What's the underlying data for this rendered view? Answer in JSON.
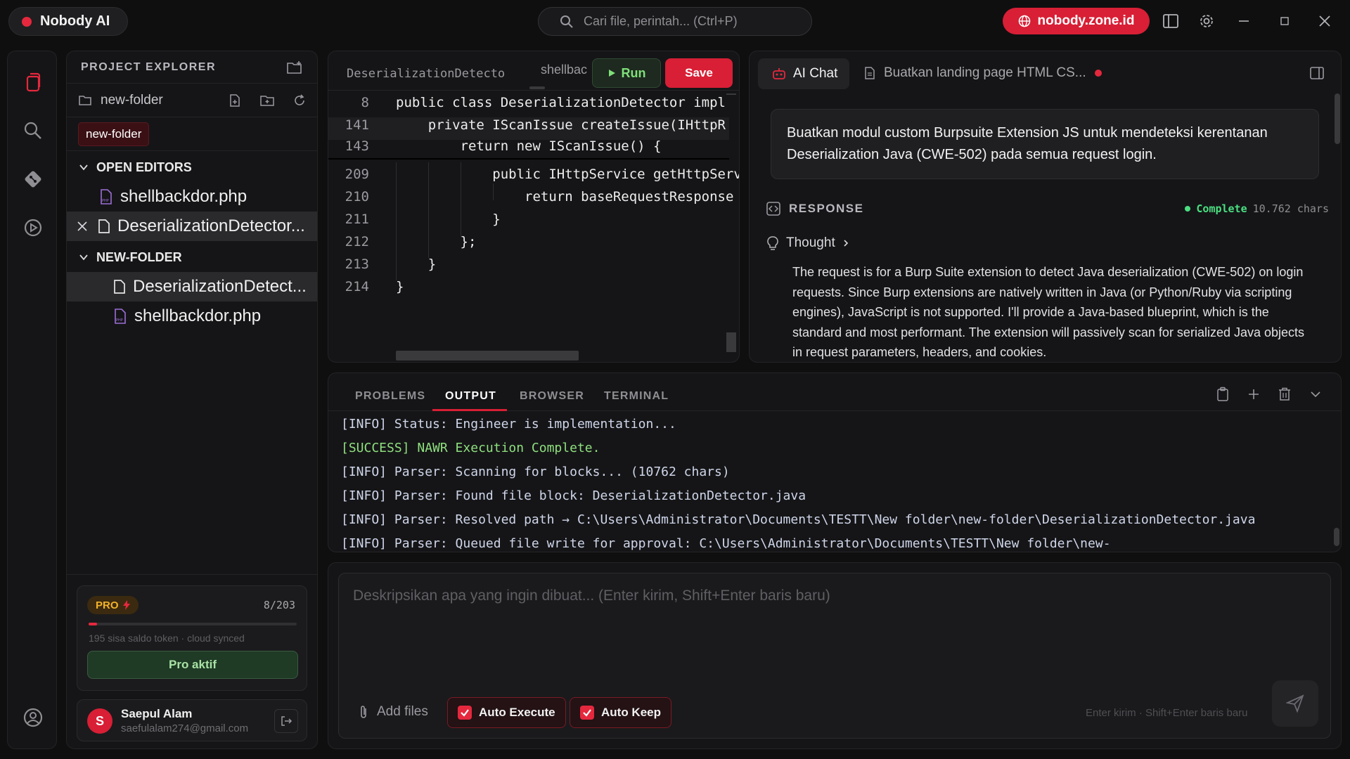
{
  "app": {
    "name": "Nobody AI",
    "site_label": "nobody.zone.id"
  },
  "search": {
    "placeholder": "Cari file, perintah... (Ctrl+P)"
  },
  "explorer": {
    "title": "PROJECT EXPLORER",
    "folder": "new-folder",
    "chip": "new-folder",
    "open_editors_label": "OPEN EDITORS",
    "open_editors": [
      {
        "name": "shellbackdor.php"
      },
      {
        "name": "DeserializationDetector..."
      }
    ],
    "folder_section_label": "NEW-FOLDER",
    "folder_files": [
      {
        "name": "DeserializationDetect..."
      },
      {
        "name": "shellbackdor.php"
      }
    ]
  },
  "plan": {
    "badge": "PRO",
    "count": "8/203",
    "progress": 0.04,
    "note": "195 sisa saldo token · cloud synced",
    "button": "Pro aktif"
  },
  "user": {
    "initial": "S",
    "name": "Saepul Alam",
    "email": "saefulalam274@gmail.com"
  },
  "editor": {
    "tabs": [
      "DeserializationDetector.ja",
      "shellbac"
    ],
    "run_label": "Run",
    "save_label": "Save",
    "lines": [
      {
        "num": "8",
        "text": "public class DeserializationDetector impl"
      },
      {
        "num": "141",
        "text": "    private IScanIssue createIssue(IHttpR"
      },
      {
        "num": "143",
        "text": "        return new IScanIssue() {"
      },
      {
        "num": "209",
        "text": "            public IHttpService getHttpServ"
      },
      {
        "num": "210",
        "text": "                return baseRequestResponse"
      },
      {
        "num": "211",
        "text": "            }"
      },
      {
        "num": "212",
        "text": "        };"
      },
      {
        "num": "213",
        "text": "    }"
      },
      {
        "num": "214",
        "text": "}"
      }
    ]
  },
  "chat": {
    "tab_active": "AI Chat",
    "tab_other": "Buatkan landing page HTML CS...",
    "user_message": "Buatkan modul custom Burpsuite Extension JS untuk mendeteksi kerentanan Deserialization Java (CWE-502) pada semua request login.",
    "response_label": "RESPONSE",
    "status": "Complete",
    "chars": "10.762 chars",
    "thought_label": "Thought",
    "thought_text": "The request is for a Burp Suite extension to detect Java deserialization (CWE-502) on login requests. Since Burp extensions are natively written in Java (or Python/Ruby via scripting engines), JavaScript is not supported. I'll provide a Java-based blueprint, which is the standard and most performant. The extension will passively scan for serialized Java objects in request parameters, headers, and cookies."
  },
  "panel": {
    "tabs": [
      "PROBLEMS",
      "OUTPUT",
      "BROWSER",
      "TERMINAL"
    ],
    "active_tab": "OUTPUT",
    "logs": [
      "[INFO] Status: Engineer is implementation...",
      "[SUCCESS] NAWR Execution Complete.",
      "[INFO] Parser: Scanning for blocks... (10762 chars)",
      "[INFO] Parser: Found file block: DeserializationDetector.java",
      "[INFO] Parser: Resolved path → C:\\Users\\Administrator\\Documents\\TESTT\\New folder\\new-folder\\DeserializationDetector.java",
      "[INFO] Parser: Queued file write for approval: C:\\Users\\Administrator\\Documents\\TESTT\\New folder\\new-"
    ]
  },
  "composer": {
    "placeholder": "Deskripsikan apa yang ingin dibuat... (Enter kirim, Shift+Enter baris baru)",
    "add_files": "Add files",
    "auto_execute": "Auto Execute",
    "auto_keep": "Auto Keep",
    "hint": "Enter kirim · Shift+Enter baris baru"
  },
  "colors": {
    "accent": "#d81f35",
    "success": "#4ade80",
    "background": "#0f0f10",
    "panel": "#151517"
  },
  "icons": [
    "search-icon",
    "globe-icon",
    "sidebar-toggle-icon",
    "settings-icon",
    "minimize-icon",
    "maximize-icon",
    "close-icon",
    "files-icon",
    "git-icon",
    "run-debug-icon",
    "account-icon",
    "new-folder-icon",
    "folder-icon",
    "new-file-icon",
    "refresh-icon",
    "php-file-icon",
    "file-icon",
    "play-icon",
    "robot-icon",
    "code-icon",
    "lightbulb-icon",
    "clipboard-icon",
    "plus-icon",
    "trash-icon",
    "chevron-down-icon",
    "paperclip-icon",
    "check-icon",
    "send-icon",
    "logout-icon",
    "bolt-icon"
  ]
}
